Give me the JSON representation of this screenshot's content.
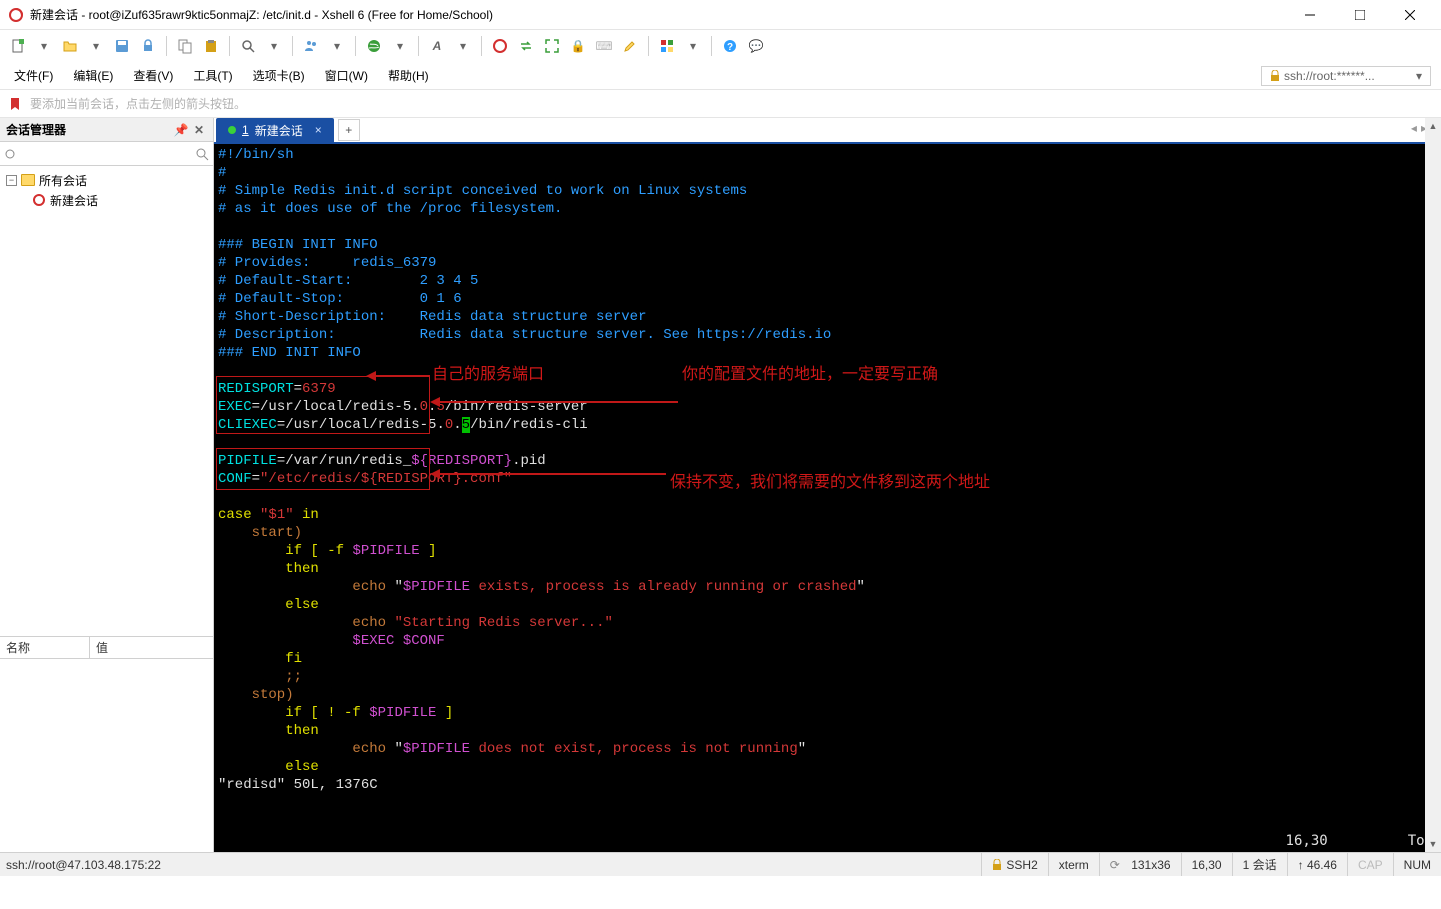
{
  "title": "新建会话 - root@iZuf635rawr9ktic5onmajZ: /etc/init.d - Xshell 6 (Free for Home/School)",
  "menu": {
    "file": "文件(F)",
    "edit": "编辑(E)",
    "view": "查看(V)",
    "tools": "工具(T)",
    "tabs": "选项卡(B)",
    "window": "窗口(W)",
    "help": "帮助(H)"
  },
  "ssh_addr": "ssh://root:******...",
  "tip": "要添加当前会话，点击左侧的箭头按钮。",
  "sidebar": {
    "title": "会话管理器",
    "root": "所有会话",
    "child": "新建会话",
    "props_name": "名称",
    "props_value": "值"
  },
  "tab": {
    "index": "1",
    "label": "新建会话"
  },
  "terminal": {
    "l1": "#!/bin/sh",
    "l2": "#",
    "l3": "# Simple Redis init.d script conceived to work on Linux systems",
    "l4": "# as it does use of the /proc filesystem.",
    "l5": "### BEGIN INIT INFO",
    "l6": "# Provides:     redis_6379",
    "l7": "# Default-Start:        2 3 4 5",
    "l8": "# Default-Stop:         0 1 6",
    "l9": "# Short-Description:    Redis data structure server",
    "l10": "# Description:          Redis data structure server. See https://redis.io",
    "l11": "### END INIT INFO",
    "redisport_k": "REDISPORT",
    "redisport_v": "6379",
    "exec_k": "EXEC",
    "exec_p1": "=/usr/local/redis-5.",
    "exec_p2": "0",
    "exec_p3": ".",
    "exec_p4": "5",
    "exec_p5": "/bin/redis-server",
    "cli_k": "CLIEXEC",
    "cli_p1": "=/usr/local/redis-5.",
    "cli_p2": "0",
    "cli_p3": ".",
    "cli_p4": "5",
    "cli_p5": "/bin/redis-cli",
    "pid_k": "PIDFILE",
    "pid_p1": "=/var/run/redis_",
    "pid_p2": "${REDISPORT}",
    "pid_p3": ".pid",
    "conf_k": "CONF",
    "conf_p1": "=",
    "conf_p2": "\"/etc/redis/${REDISPORT}.conf\"",
    "case1": "case ",
    "case2": "\"$1\"",
    "case3": " in",
    "start": "    start)",
    "if1a": "        if ",
    "if1b": "[ -f ",
    "if1c": "$PIDFILE ",
    "if1d": "]",
    "then": "        then",
    "echo1a": "                echo ",
    "echo1b": "\"",
    "echo1c": "$PIDFILE",
    "echo1d": " exists, process is already running or crashed",
    "echo1e": "\"",
    "else": "        else",
    "echo2a": "                echo ",
    "echo2b": "\"Starting Redis server...\"",
    "execln": "                $EXEC $CONF",
    "fi": "        fi",
    "dsemi": "        ;;",
    "stop": "    stop)",
    "if2a": "        if ",
    "if2b": "[ ! -f ",
    "if2c": "$PIDFILE ",
    "if2d": "]",
    "then2": "        then",
    "echo3a": "                echo ",
    "echo3b": "\"",
    "echo3c": "$PIDFILE",
    "echo3d": " does not exist, process is not running",
    "echo3e": "\"",
    "else2": "        else",
    "fstatus": "\"redisd\" 50L, 1376C",
    "cursor": "16,30",
    "scroll": "Top"
  },
  "annotations": {
    "a1": "自己的服务端口",
    "a2": "你的配置文件的地址，一定要写正确",
    "a3": "保持不变，我们将需要的文件移到这两个地址"
  },
  "status": {
    "conn": "ssh://root@47.103.48.175:22",
    "proto": "SSH2",
    "term": "xterm",
    "size": "131x36",
    "rc_a": "16,30",
    "sess": "1 会话",
    "cap": "CAP",
    "num": "NUM",
    "time": "↑ 46.46"
  }
}
